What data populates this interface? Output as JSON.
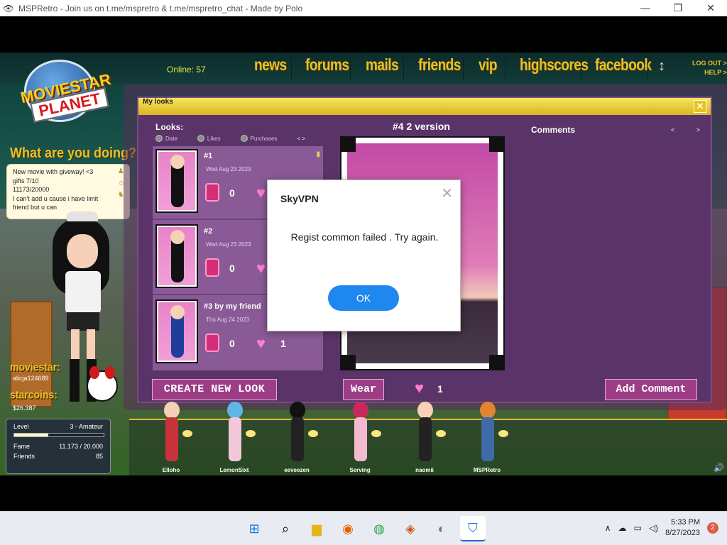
{
  "window": {
    "title": "MSPRetro - Join us on t.me/mspretro & t.me/mspretro_chat - Made by Polo",
    "icon": "eye-icon",
    "buttons": [
      "minimize",
      "restore",
      "close"
    ]
  },
  "game": {
    "logo": {
      "line1": "MOVIESTAR",
      "line2": "PLANET"
    },
    "online": "Online: 57",
    "nav": [
      "news",
      "forums",
      "mails",
      "friends",
      "vip",
      "highscores",
      "facebook"
    ],
    "updown_icon": "updown-arrow-icon",
    "logout": "LOG OUT >",
    "help": "HELP >",
    "what_doing": "What are you doing?",
    "status_lines": [
      "New movie with  giveway! <3",
      "gifts 7/10",
      "11173/20000",
      "I can't add u cause i have limit",
      "friend but u can"
    ],
    "moviestar_label": "moviestar:",
    "username": "alicja124689",
    "starcoins_label": "starcoins:",
    "starcoins": "$26.387",
    "level": {
      "label": "Level",
      "value": "3 - Amateur",
      "progress": 0.38
    },
    "fame": {
      "label": "Fame",
      "value": "11.173 / 20.000"
    },
    "friends": {
      "label": "Friends",
      "value": "85"
    }
  },
  "dialog": {
    "title": "My looks",
    "looks_heading": "Looks:",
    "sort": [
      "Date",
      "Likes",
      "Purchases"
    ],
    "sort_arrows": "<  >",
    "looks": [
      {
        "title": "#1",
        "date": "Wed Aug 23 2023",
        "purchases": "0",
        "likes": ""
      },
      {
        "title": "#2",
        "date": "Wed Aug 23 2023",
        "purchases": "0",
        "likes": ""
      },
      {
        "title": "#3 by my friend",
        "date": "Thu Aug 24 2023",
        "purchases": "0",
        "likes": "1"
      }
    ],
    "version_heading": "#4 2 version",
    "comments_heading": "Comments",
    "comments_nav": "< >",
    "create_button": "CREATE NEW LOOK",
    "wear_button": "Wear",
    "like_count": "1",
    "add_comment_button": "Add Comment"
  },
  "buddies": [
    {
      "name": "Elloho",
      "head": "#f6d1b8",
      "body": "#c8323b"
    },
    {
      "name": "LemonSixt",
      "head": "#5fb7e5",
      "body": "#f0c8d8"
    },
    {
      "name": "eeveezen",
      "head": "#111111",
      "body": "#222222"
    },
    {
      "name": "Serving",
      "head": "#c9285a",
      "body": "#f3b9cf"
    },
    {
      "name": "naomii",
      "head": "#f6d1b8",
      "body": "#222222"
    },
    {
      "name": "MSPRetro",
      "head": "#e28532",
      "body": "#3e6aa8"
    }
  ],
  "modal": {
    "title": "SkyVPN",
    "message": "Regist common failed . Try again.",
    "ok": "OK"
  },
  "taskbar": {
    "apps": [
      "windows-start-icon",
      "search-icon",
      "file-explorer-icon",
      "firefox-icon",
      "chrome-icon",
      "paint-icon",
      "game-icon",
      "skyvpn-icon"
    ],
    "time": "5:33 PM",
    "date": "8/27/2023",
    "notifications": "2"
  }
}
